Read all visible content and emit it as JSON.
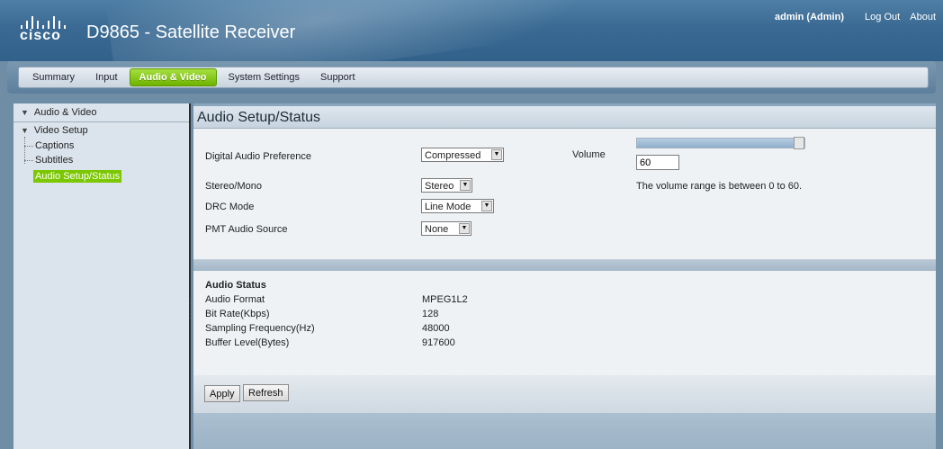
{
  "header": {
    "logo_text": "cisco",
    "title": "D9865 - Satellite Receiver",
    "user": "admin (Admin)",
    "logout": "Log Out",
    "about": "About"
  },
  "nav": {
    "tabs": [
      "Summary",
      "Input",
      "Audio & Video",
      "System Settings",
      "Support"
    ],
    "active": "Audio & Video"
  },
  "sidebar": {
    "root": "Audio & Video",
    "video_setup": "Video Setup",
    "captions": "Captions",
    "subtitles": "Subtitles",
    "audio_setup": "Audio Setup/Status"
  },
  "main": {
    "title": "Audio Setup/Status",
    "digital_audio_pref_label": "Digital Audio Preference",
    "digital_audio_pref_value": "Compressed",
    "stereo_mono_label": "Stereo/Mono",
    "stereo_mono_value": "Stereo",
    "drc_mode_label": "DRC Mode",
    "drc_mode_value": "Line Mode",
    "pmt_audio_label": "PMT Audio Source",
    "pmt_audio_value": "None",
    "volume_label": "Volume",
    "volume_value": "60",
    "volume_level_fraction": 1.0,
    "volume_hint": "The volume range is between 0 to 60."
  },
  "status": {
    "heading": "Audio Status",
    "rows": [
      {
        "label": "Audio Format",
        "value": "MPEG1L2"
      },
      {
        "label": "Bit Rate(Kbps)",
        "value": "128"
      },
      {
        "label": "Sampling Frequency(Hz)",
        "value": "48000"
      },
      {
        "label": "Buffer Level(Bytes)",
        "value": "917600"
      }
    ]
  },
  "buttons": {
    "apply": "Apply",
    "refresh": "Refresh"
  },
  "icons": {
    "dropdown_arrow": "▼",
    "tree_expanded": "▼"
  }
}
